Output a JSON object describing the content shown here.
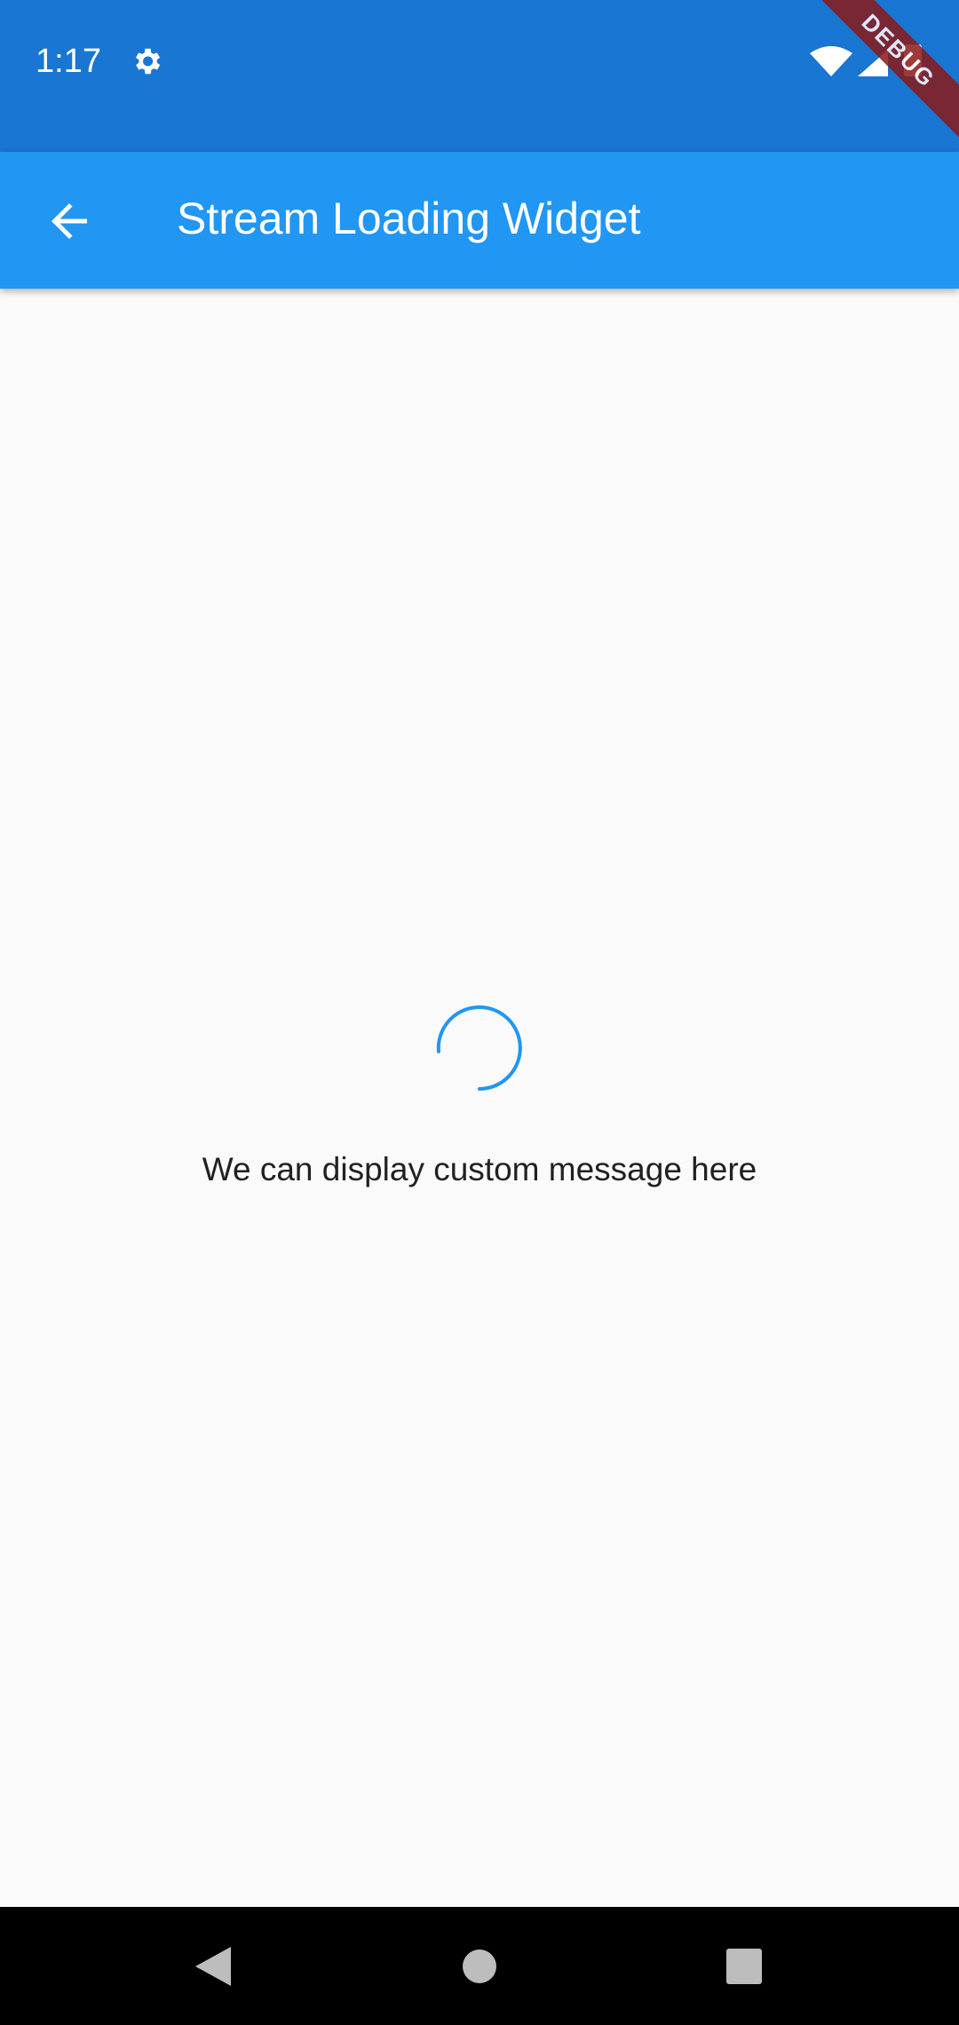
{
  "status_bar": {
    "time": "1:17",
    "debug_banner": "DEBUG"
  },
  "app_bar": {
    "title": "Stream Loading Widget"
  },
  "content": {
    "message": "We can display custom message here"
  },
  "colors": {
    "status_bar": "#1976d2",
    "app_bar": "#2196f3",
    "accent": "#2196f3"
  }
}
